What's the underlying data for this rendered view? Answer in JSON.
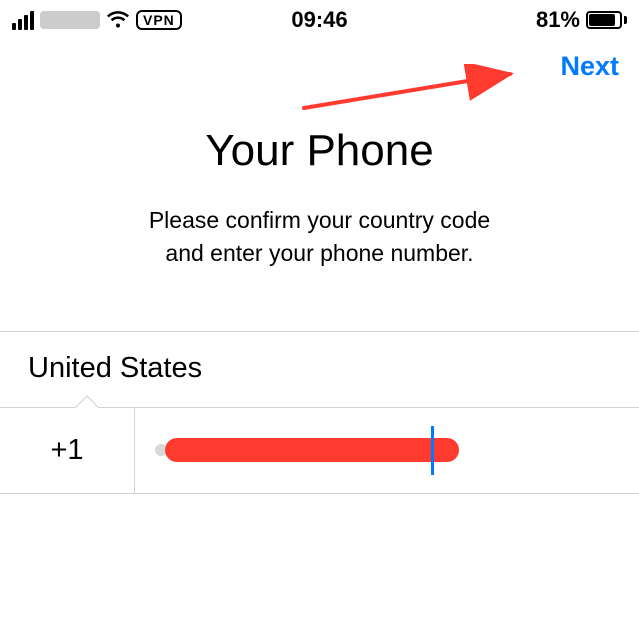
{
  "status_bar": {
    "time": "09:46",
    "vpn_label": "VPN",
    "battery_percent_text": "81%",
    "battery_fill_pct": "81%"
  },
  "nav": {
    "next_label": "Next"
  },
  "header": {
    "title": "Your Phone",
    "subtitle_line1": "Please confirm your country code",
    "subtitle_line2": "and enter your phone number."
  },
  "phone_entry": {
    "country_name": "United States",
    "country_code": "+1",
    "phone_value": ""
  },
  "annotation": {
    "arrow_color": "#ff3b30"
  }
}
